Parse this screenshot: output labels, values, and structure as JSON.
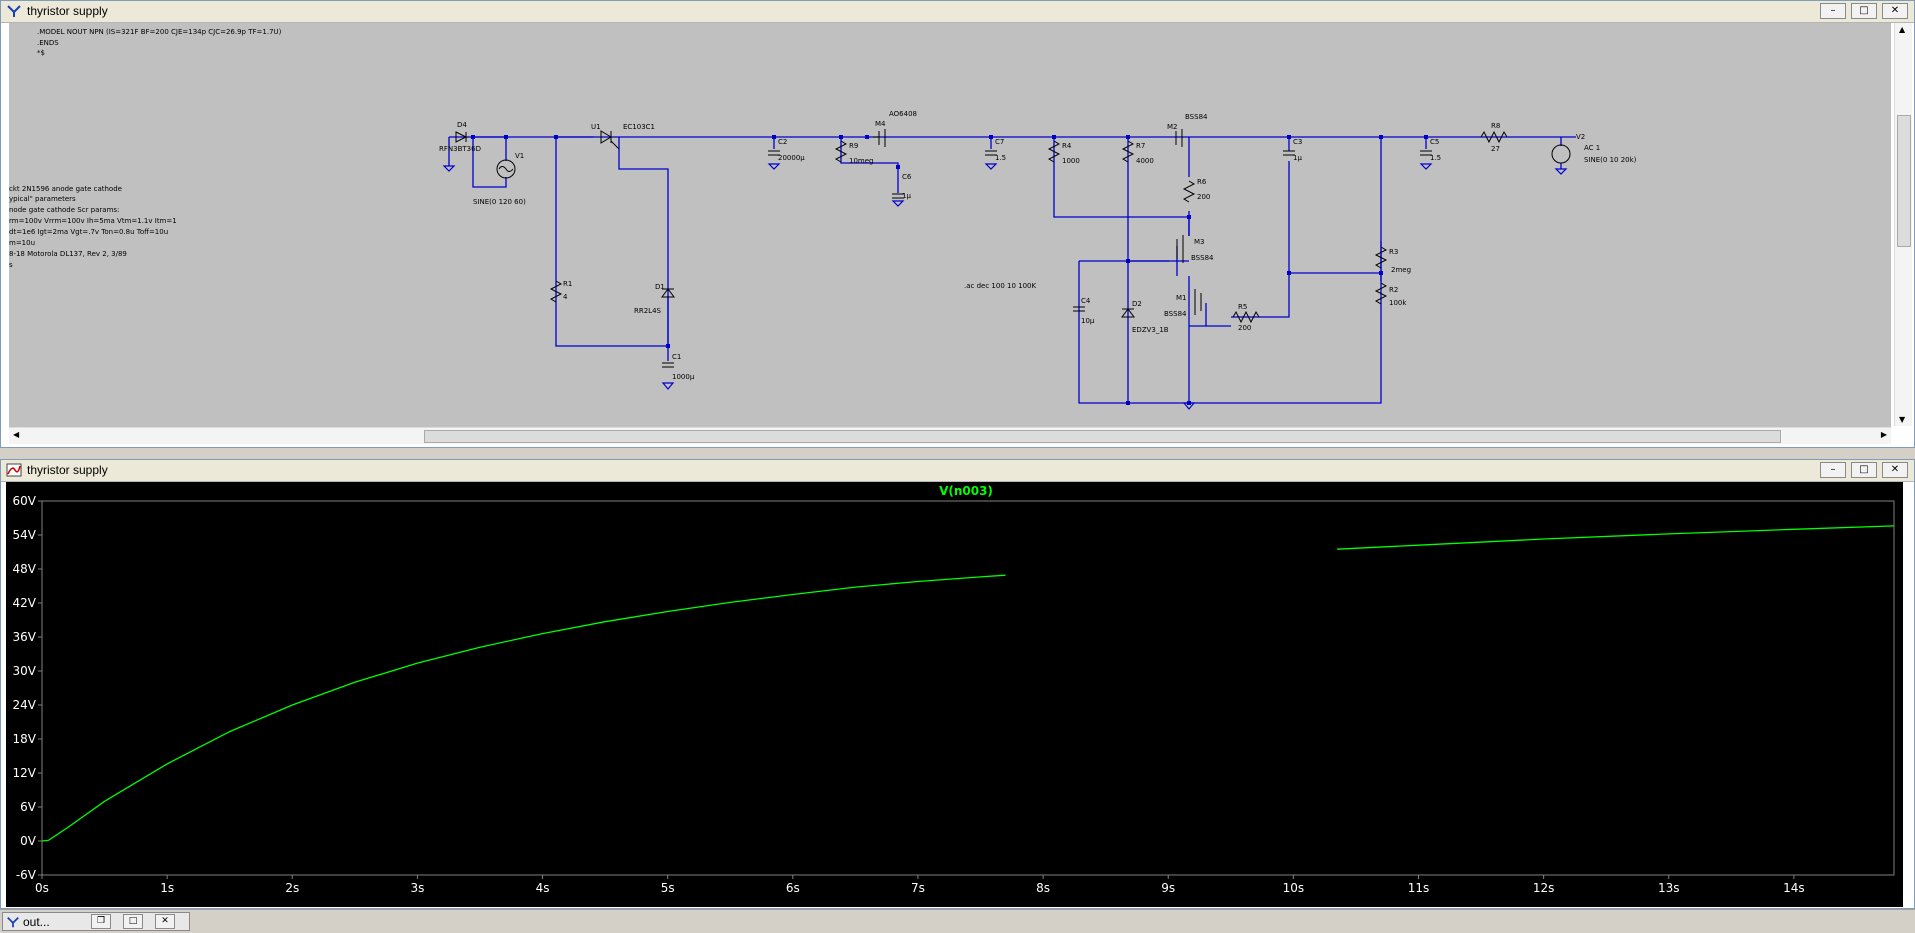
{
  "schematic_window": {
    "title": "thyristor supply",
    "spice_header": [
      ".MODEL NOUT NPN (IS=321F BF=200 CJE=134p CJC=26.9p TF=1.7U)",
      ".ENDS",
      "*$"
    ],
    "scr_comment": [
      "ckt 2N1596        anode gate cathode",
      "ypical\" parameters",
      "node gate cathode Scr params:",
      "rm=100v  Vrrm=100v   Ih=5ma      Vtm=1.1v    Itm=1",
      "dt=1e6  Igt=2ma     Vgt=.7v    Ton=0.8u    Toff=10u",
      "m=10u",
      "8-18    Motorola     DL137, Rev 2, 3/89",
      "s"
    ],
    "components": {
      "D4": "D4",
      "D4_model": "RFN3BT36D",
      "V1": "V1",
      "V1_value": "SINE(0 120 60)",
      "U1": "U1",
      "U1_model": "EC103C1",
      "R1": "R1",
      "R1_value": "4",
      "D1": "D1",
      "D1_model": "RR2L4S",
      "C1": "C1",
      "C1_value": "1000µ",
      "C2": "C2",
      "C2_value": "20000µ",
      "R9": "R9",
      "R9_value": "10meg",
      "M4": "M4",
      "M4_model": "AO6408",
      "C6": "C6",
      "C6_value": "1µ",
      "C7": "C7",
      "C7_value": "1.5",
      "R4": "R4",
      "R4_value": "1000",
      "R7": "R7",
      "R7_value": "4000",
      "M2": "M2",
      "M2_model": "BSS84",
      "R6": "R6",
      "R6_value": "200",
      "M3": "M3",
      "M3_model": "BSS84",
      "C4": "C4",
      "C4_value": "10µ",
      "D2": "D2",
      "D2_model": "EDZV3_1B",
      "M1": "M1",
      "M1_model": "BSS84",
      "R5": "R5",
      "R5_value": "200",
      "C3": "C3",
      "C3_value": "1µ",
      "R3": "R3",
      "R3_value": "2meg",
      "R2": "R2",
      "R2_value": "100k",
      "C5": "C5",
      "C5_value": "1.5",
      "R8": "R8",
      "R8_value": "27",
      "V2": "V2",
      "V2_ac": "AC 1",
      "V2_value": "SINE(0 10 20k)"
    },
    "directive": ".ac dec 100 10 100K"
  },
  "plot_window": {
    "title": "thyristor supply",
    "trace_name": "V(n003)",
    "trace_color": "#00ff00",
    "grid_color": "#808080"
  },
  "chart_data": {
    "type": "line",
    "title": "V(n003)",
    "xlabel": "",
    "ylabel": "",
    "xlim": [
      0,
      14.8
    ],
    "ylim": [
      -6,
      60
    ],
    "x_ticks": [
      "0s",
      "1s",
      "2s",
      "3s",
      "4s",
      "5s",
      "6s",
      "7s",
      "8s",
      "9s",
      "10s",
      "11s",
      "12s",
      "13s",
      "14s"
    ],
    "y_ticks": [
      "60V",
      "54V",
      "48V",
      "42V",
      "36V",
      "30V",
      "24V",
      "18V",
      "12V",
      "6V",
      "0V",
      "-6V"
    ],
    "series": [
      {
        "name": "V(n003)",
        "segments": [
          {
            "x": [
              0,
              0.05,
              0.2,
              0.5,
              1,
              1.5,
              2,
              2.5,
              3,
              3.5,
              4,
              4.5,
              5,
              5.5,
              6,
              6.5,
              7,
              7.5,
              7.7
            ],
            "y": [
              0,
              0.1,
              2.3,
              7.0,
              13.6,
              19.3,
              24.0,
              28.0,
              31.4,
              34.2,
              36.6,
              38.7,
              40.5,
              42.1,
              43.5,
              44.8,
              45.8,
              46.6,
              46.9
            ]
          },
          {
            "x": [
              10.35,
              11,
              12,
              13,
              14,
              14.8
            ],
            "y": [
              51.5,
              52.2,
              53.3,
              54.2,
              55.0,
              55.6
            ]
          }
        ]
      }
    ]
  },
  "taskbar": {
    "item_label": "out...",
    "buttons": [
      "restore",
      "maximize",
      "close"
    ]
  }
}
